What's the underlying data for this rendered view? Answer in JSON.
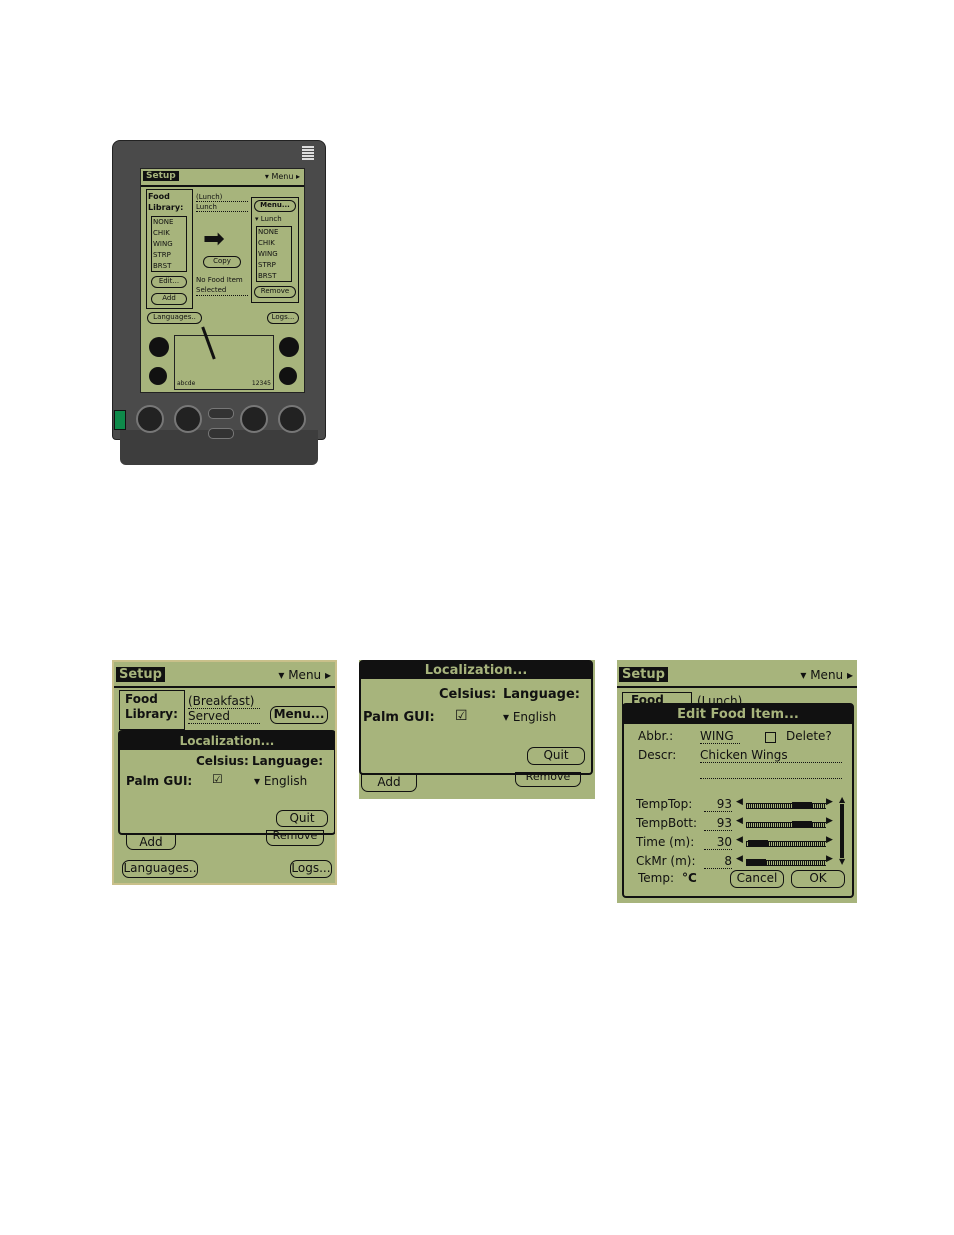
{
  "colors": {
    "lcd": "#a7b47c",
    "ink": "#111111",
    "device_body": "#4a4a4a",
    "power_led": "#0e8a4a"
  },
  "device": {
    "tab": "Setup",
    "menu": "Menu",
    "food_library_label": "Food Library:",
    "left_list": [
      "NONE",
      "CHIK",
      "WING",
      "STRP",
      "BRST"
    ],
    "edit_button": "Edit...",
    "add_button": "Add",
    "meal_header": "(Lunch)",
    "meal_value": "Lunch",
    "copy_button": "Copy",
    "status": "No Food Item Selected",
    "menu_button": "Menu...",
    "menu_dropdown": "Lunch",
    "right_list": [
      "NONE",
      "CHIK",
      "WING",
      "STRP",
      "BRST"
    ],
    "remove_button": "Remove",
    "languages_button": "Languages..",
    "logs_button": "Logs...",
    "graffiti_left": "abcde",
    "graffiti_right": "12345",
    "silk_icons": [
      "applications-icon",
      "menu-icon",
      "calculator-icon",
      "find-icon"
    ],
    "hard_buttons": [
      "date-book-icon",
      "phone-icon",
      "scroll-up",
      "scroll-down",
      "todo-icon",
      "memo-icon"
    ]
  },
  "panel1": {
    "tab": "Setup",
    "menu": "Menu",
    "food_library_label": "Food Library:",
    "meal_header": "(Breakfast)",
    "meal_value": "Served",
    "menu_button": "Menu...",
    "dialog": {
      "title": "Localization...",
      "celsius_label": "Celsius:",
      "language_label": "Language:",
      "palm_gui_label": "Palm GUI:",
      "celsius_checked": true,
      "language": "English",
      "quit": "Quit"
    },
    "add_button": "Add",
    "remove_button": "Remove",
    "languages_button": "Languages..",
    "logs_button": "Logs..."
  },
  "panel2": {
    "dialog": {
      "title": "Localization...",
      "celsius_label": "Celsius:",
      "language_label": "Language:",
      "palm_gui_label": "Palm GUI:",
      "celsius_checked": true,
      "language": "English",
      "quit": "Quit"
    },
    "add_button": "Add",
    "remove_button": "Remove"
  },
  "panel3": {
    "tab": "Setup",
    "menu": "Menu",
    "food_label": "Food",
    "meal_header": "(Lunch)",
    "dialog": {
      "title": "Edit Food Item...",
      "abbr_label": "Abbr.:",
      "abbr_value": "WING",
      "delete_label": "Delete?",
      "delete_checked": false,
      "descr_label": "Descr:",
      "descr_value": "Chicken Wings",
      "rows": [
        {
          "label": "TempTop:",
          "value": "93",
          "fraction": 0.85
        },
        {
          "label": "TempBott:",
          "value": "93",
          "fraction": 0.85
        },
        {
          "label": "Time (m):",
          "value": "30",
          "fraction": 0.3
        },
        {
          "label": "CkMr (m):",
          "value": "8",
          "fraction": 0.08
        }
      ],
      "temp_label": "Temp:",
      "temp_unit": "°C",
      "cancel": "Cancel",
      "ok": "OK"
    }
  }
}
